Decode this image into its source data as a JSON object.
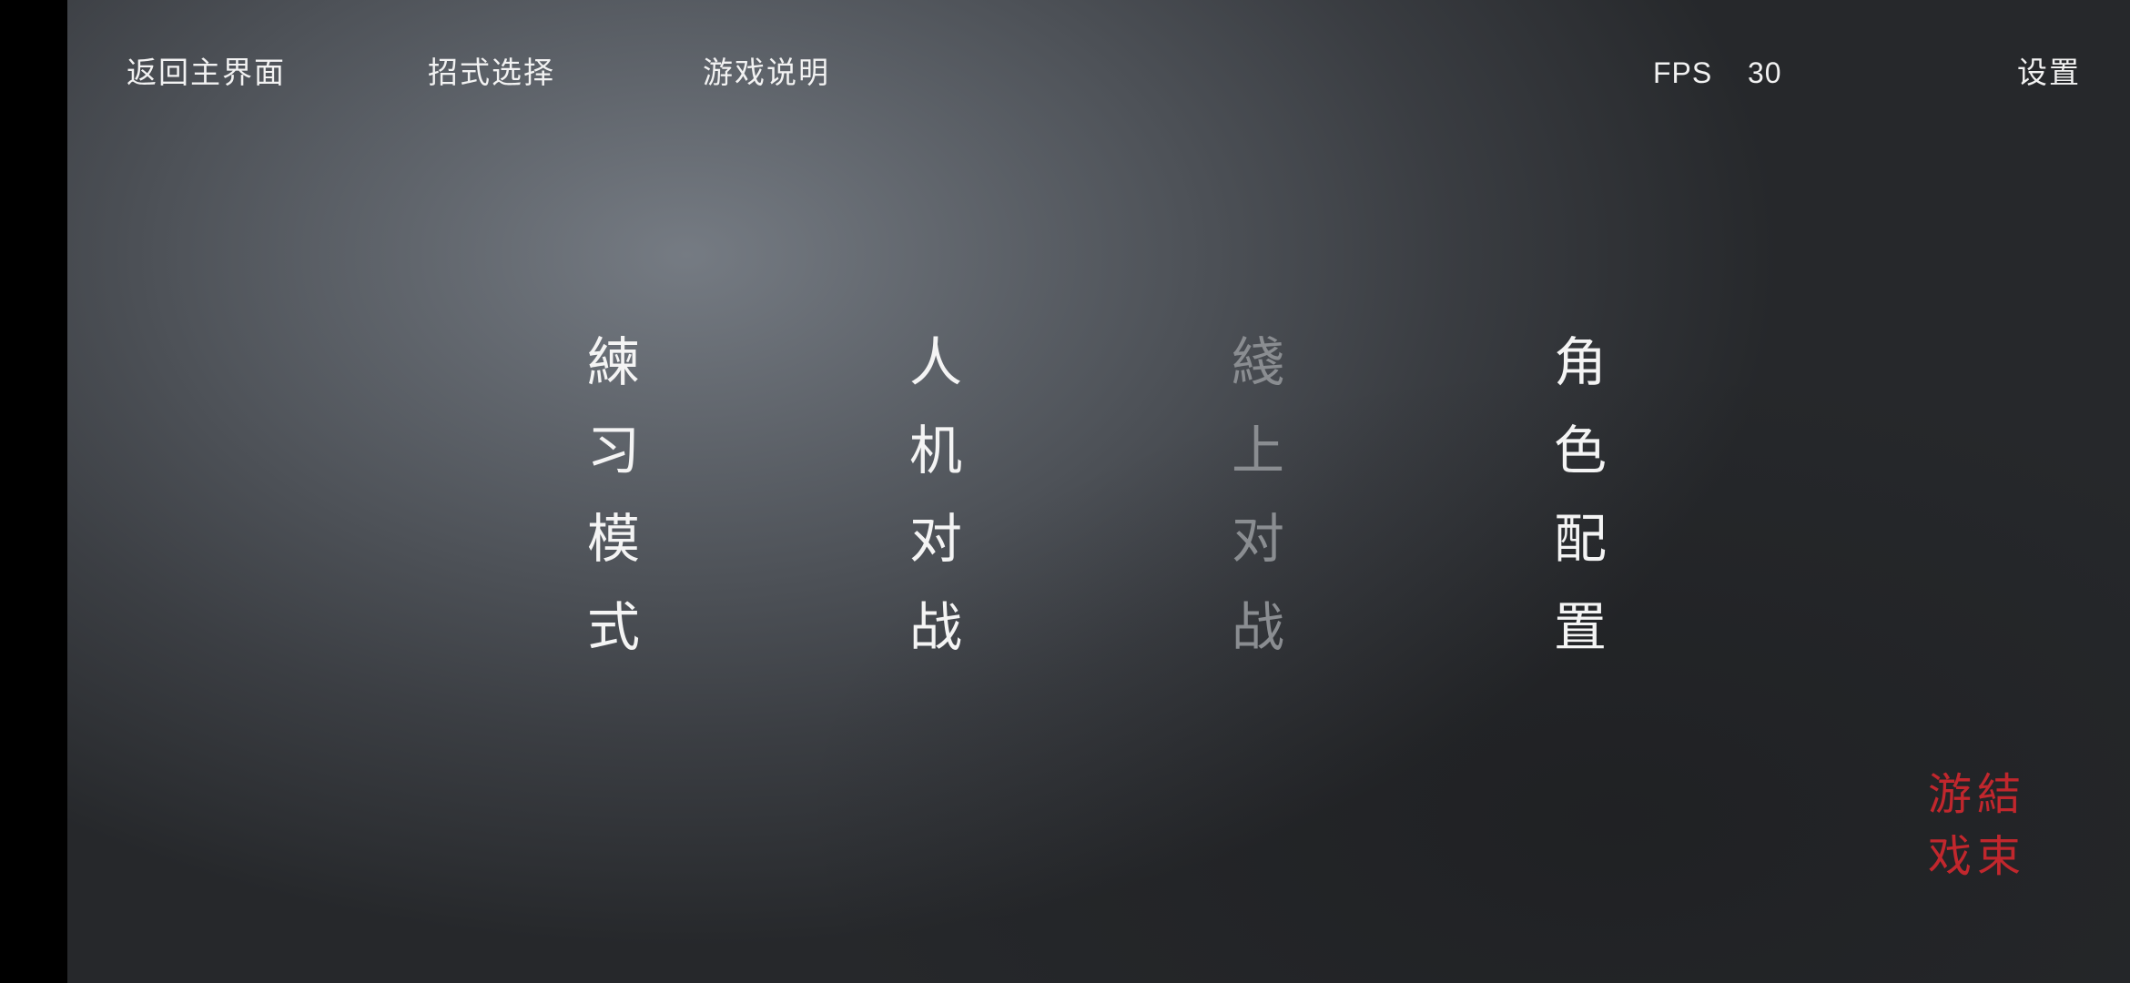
{
  "nav": {
    "back_to_main": "返回主界面",
    "move_select": "招式选择",
    "game_guide": "游戏说明",
    "settings": "设置"
  },
  "fps": {
    "label": "FPS",
    "value": "30"
  },
  "modes": [
    {
      "chars": [
        "練",
        "习",
        "模",
        "式"
      ],
      "enabled": true
    },
    {
      "chars": [
        "人",
        "机",
        "对",
        "战"
      ],
      "enabled": true
    },
    {
      "chars": [
        "綫",
        "上",
        "对",
        "战"
      ],
      "enabled": false
    },
    {
      "chars": [
        "角",
        "色",
        "配",
        "置"
      ],
      "enabled": true
    }
  ],
  "quit": {
    "chars": [
      "游",
      "結",
      "戏",
      "束"
    ]
  },
  "colors": {
    "text": "#f2f2f2",
    "disabled_text": "#8a8d91",
    "quit_red": "#c1272d"
  }
}
